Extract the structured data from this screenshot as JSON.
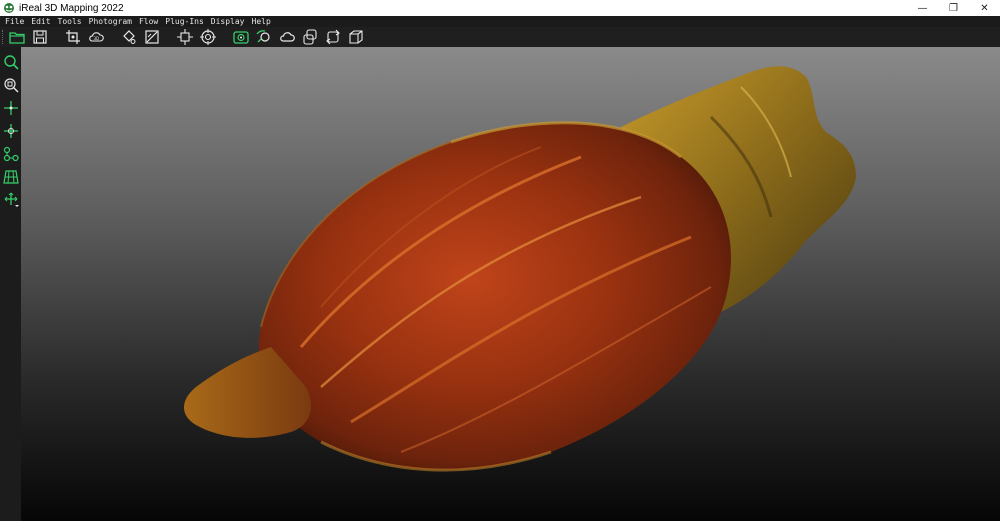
{
  "window": {
    "title": "iReal 3D Mapping 2022",
    "controls": {
      "minimize": "—",
      "restore": "❐",
      "close": "✕"
    }
  },
  "menu": [
    {
      "label": "File"
    },
    {
      "label": "Edit"
    },
    {
      "label": "Tools"
    },
    {
      "label": "Photogram"
    },
    {
      "label": "Flow"
    },
    {
      "label": "Plug-Ins"
    },
    {
      "label": "Display"
    },
    {
      "label": "Help"
    }
  ],
  "toolbar": {
    "icons": [
      "open-folder-icon",
      "save-icon",
      "crop-icon",
      "cloud-icon",
      "paint-bucket-icon",
      "image-edit-icon",
      "pan-cross-icon",
      "target-icon",
      "scan-camera-icon",
      "mapping-icon",
      "cloud-outline-icon",
      "layers-icon",
      "refresh-icon",
      "cube-icon"
    ]
  },
  "left_toolbar": {
    "icons": [
      "zoom-icon",
      "zoom-fit-icon",
      "pick-point-icon",
      "add-point-icon",
      "connect-nodes-icon",
      "grid-mesh-icon",
      "move-icon"
    ]
  },
  "colors": {
    "accent": "#35d06a",
    "titlebar_bg": "#ffffff",
    "menubar_bg": "#1b1b1b",
    "toolbar_bg": "#1f1f1f",
    "viewport_top": "#8a8a8a",
    "viewport_bottom": "#060606",
    "model_body": "#8a2a0e",
    "model_stem": "#a8801e"
  }
}
